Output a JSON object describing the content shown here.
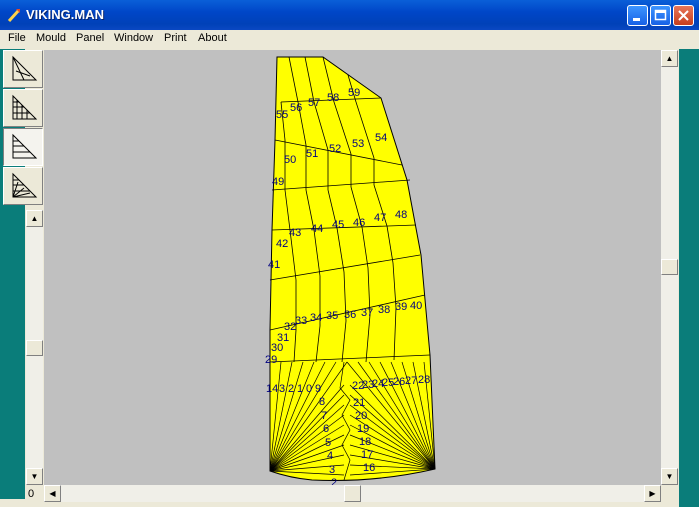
{
  "window": {
    "title": "VIKING.MAN"
  },
  "menu": [
    "File",
    "Mould",
    "Panel",
    "Window",
    "Print",
    "About"
  ],
  "tools": [
    {
      "icon": "sail-outline-icon"
    },
    {
      "icon": "sail-grid-icon"
    },
    {
      "icon": "sail-horizontal-panels-icon"
    },
    {
      "icon": "sail-cross-grid-icon"
    }
  ],
  "status": {
    "corner_value": "0"
  },
  "sail": {
    "color": "#ffff00",
    "label_color": "#000080",
    "upper_labels": [
      "55",
      "56",
      "57",
      "58",
      "59",
      "50",
      "51",
      "52",
      "53",
      "54",
      "49",
      "43",
      "44",
      "45",
      "46",
      "47",
      "48",
      "42",
      "41",
      "32",
      "33",
      "34",
      "35",
      "36",
      "37",
      "38",
      "39",
      "40",
      "31",
      "30",
      "29"
    ],
    "foot_labels": [
      "14",
      "3",
      "2",
      "1",
      "0",
      "9",
      "8",
      "7",
      "6",
      "5",
      "4",
      "3",
      "2",
      "1",
      "22",
      "23",
      "24",
      "25",
      "26",
      "27",
      "28",
      "21",
      "20",
      "19",
      "18",
      "17",
      "16",
      "15"
    ]
  }
}
